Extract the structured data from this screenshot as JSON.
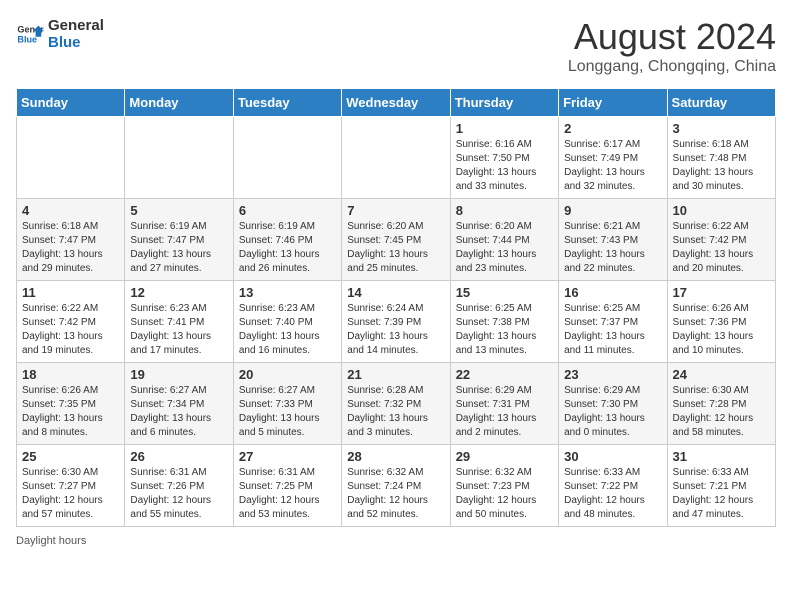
{
  "header": {
    "logo_general": "General",
    "logo_blue": "Blue",
    "month_year": "August 2024",
    "location": "Longgang, Chongqing, China"
  },
  "days_of_week": [
    "Sunday",
    "Monday",
    "Tuesday",
    "Wednesday",
    "Thursday",
    "Friday",
    "Saturday"
  ],
  "weeks": [
    [
      {
        "day": "",
        "info": ""
      },
      {
        "day": "",
        "info": ""
      },
      {
        "day": "",
        "info": ""
      },
      {
        "day": "",
        "info": ""
      },
      {
        "day": "1",
        "info": "Sunrise: 6:16 AM\nSunset: 7:50 PM\nDaylight: 13 hours and 33 minutes."
      },
      {
        "day": "2",
        "info": "Sunrise: 6:17 AM\nSunset: 7:49 PM\nDaylight: 13 hours and 32 minutes."
      },
      {
        "day": "3",
        "info": "Sunrise: 6:18 AM\nSunset: 7:48 PM\nDaylight: 13 hours and 30 minutes."
      }
    ],
    [
      {
        "day": "4",
        "info": "Sunrise: 6:18 AM\nSunset: 7:47 PM\nDaylight: 13 hours and 29 minutes."
      },
      {
        "day": "5",
        "info": "Sunrise: 6:19 AM\nSunset: 7:47 PM\nDaylight: 13 hours and 27 minutes."
      },
      {
        "day": "6",
        "info": "Sunrise: 6:19 AM\nSunset: 7:46 PM\nDaylight: 13 hours and 26 minutes."
      },
      {
        "day": "7",
        "info": "Sunrise: 6:20 AM\nSunset: 7:45 PM\nDaylight: 13 hours and 25 minutes."
      },
      {
        "day": "8",
        "info": "Sunrise: 6:20 AM\nSunset: 7:44 PM\nDaylight: 13 hours and 23 minutes."
      },
      {
        "day": "9",
        "info": "Sunrise: 6:21 AM\nSunset: 7:43 PM\nDaylight: 13 hours and 22 minutes."
      },
      {
        "day": "10",
        "info": "Sunrise: 6:22 AM\nSunset: 7:42 PM\nDaylight: 13 hours and 20 minutes."
      }
    ],
    [
      {
        "day": "11",
        "info": "Sunrise: 6:22 AM\nSunset: 7:42 PM\nDaylight: 13 hours and 19 minutes."
      },
      {
        "day": "12",
        "info": "Sunrise: 6:23 AM\nSunset: 7:41 PM\nDaylight: 13 hours and 17 minutes."
      },
      {
        "day": "13",
        "info": "Sunrise: 6:23 AM\nSunset: 7:40 PM\nDaylight: 13 hours and 16 minutes."
      },
      {
        "day": "14",
        "info": "Sunrise: 6:24 AM\nSunset: 7:39 PM\nDaylight: 13 hours and 14 minutes."
      },
      {
        "day": "15",
        "info": "Sunrise: 6:25 AM\nSunset: 7:38 PM\nDaylight: 13 hours and 13 minutes."
      },
      {
        "day": "16",
        "info": "Sunrise: 6:25 AM\nSunset: 7:37 PM\nDaylight: 13 hours and 11 minutes."
      },
      {
        "day": "17",
        "info": "Sunrise: 6:26 AM\nSunset: 7:36 PM\nDaylight: 13 hours and 10 minutes."
      }
    ],
    [
      {
        "day": "18",
        "info": "Sunrise: 6:26 AM\nSunset: 7:35 PM\nDaylight: 13 hours and 8 minutes."
      },
      {
        "day": "19",
        "info": "Sunrise: 6:27 AM\nSunset: 7:34 PM\nDaylight: 13 hours and 6 minutes."
      },
      {
        "day": "20",
        "info": "Sunrise: 6:27 AM\nSunset: 7:33 PM\nDaylight: 13 hours and 5 minutes."
      },
      {
        "day": "21",
        "info": "Sunrise: 6:28 AM\nSunset: 7:32 PM\nDaylight: 13 hours and 3 minutes."
      },
      {
        "day": "22",
        "info": "Sunrise: 6:29 AM\nSunset: 7:31 PM\nDaylight: 13 hours and 2 minutes."
      },
      {
        "day": "23",
        "info": "Sunrise: 6:29 AM\nSunset: 7:30 PM\nDaylight: 13 hours and 0 minutes."
      },
      {
        "day": "24",
        "info": "Sunrise: 6:30 AM\nSunset: 7:28 PM\nDaylight: 12 hours and 58 minutes."
      }
    ],
    [
      {
        "day": "25",
        "info": "Sunrise: 6:30 AM\nSunset: 7:27 PM\nDaylight: 12 hours and 57 minutes."
      },
      {
        "day": "26",
        "info": "Sunrise: 6:31 AM\nSunset: 7:26 PM\nDaylight: 12 hours and 55 minutes."
      },
      {
        "day": "27",
        "info": "Sunrise: 6:31 AM\nSunset: 7:25 PM\nDaylight: 12 hours and 53 minutes."
      },
      {
        "day": "28",
        "info": "Sunrise: 6:32 AM\nSunset: 7:24 PM\nDaylight: 12 hours and 52 minutes."
      },
      {
        "day": "29",
        "info": "Sunrise: 6:32 AM\nSunset: 7:23 PM\nDaylight: 12 hours and 50 minutes."
      },
      {
        "day": "30",
        "info": "Sunrise: 6:33 AM\nSunset: 7:22 PM\nDaylight: 12 hours and 48 minutes."
      },
      {
        "day": "31",
        "info": "Sunrise: 6:33 AM\nSunset: 7:21 PM\nDaylight: 12 hours and 47 minutes."
      }
    ]
  ],
  "footer": {
    "note": "Daylight hours"
  }
}
